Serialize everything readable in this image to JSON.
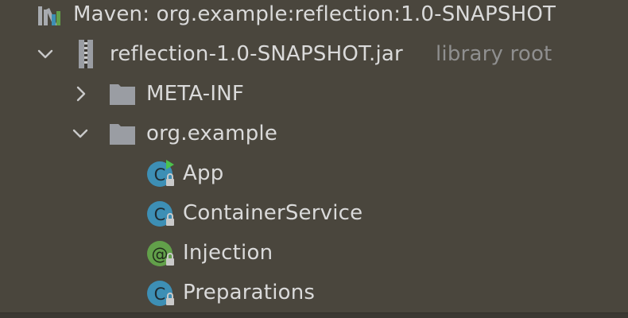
{
  "tree": {
    "root": {
      "label": "Maven: org.example:reflection:1.0-SNAPSHOT",
      "icon": "maven-library-icon"
    },
    "jar": {
      "label": "reflection-1.0-SNAPSHOT.jar",
      "hint": "library root",
      "icon": "jar-archive-icon",
      "expanded": true
    },
    "folders": [
      {
        "label": "META-INF",
        "expanded": false,
        "icon": "folder-icon"
      },
      {
        "label": "org.example",
        "expanded": true,
        "icon": "folder-icon"
      }
    ],
    "classes": [
      {
        "label": "App",
        "icon": "class-runnable-icon",
        "kind": "C"
      },
      {
        "label": "ContainerService",
        "icon": "class-icon",
        "kind": "C"
      },
      {
        "label": "Injection",
        "icon": "annotation-icon",
        "kind": "@"
      },
      {
        "label": "Preparations",
        "icon": "class-icon",
        "kind": "C"
      }
    ]
  },
  "colors": {
    "background": "#4a463d",
    "text": "#dadada",
    "secondary_text": "#8f8f8f",
    "class_icon": "#3d8fb5",
    "annotation_icon": "#62a04a",
    "run_marker": "#4cc24c",
    "folder": "#9a9da3"
  }
}
